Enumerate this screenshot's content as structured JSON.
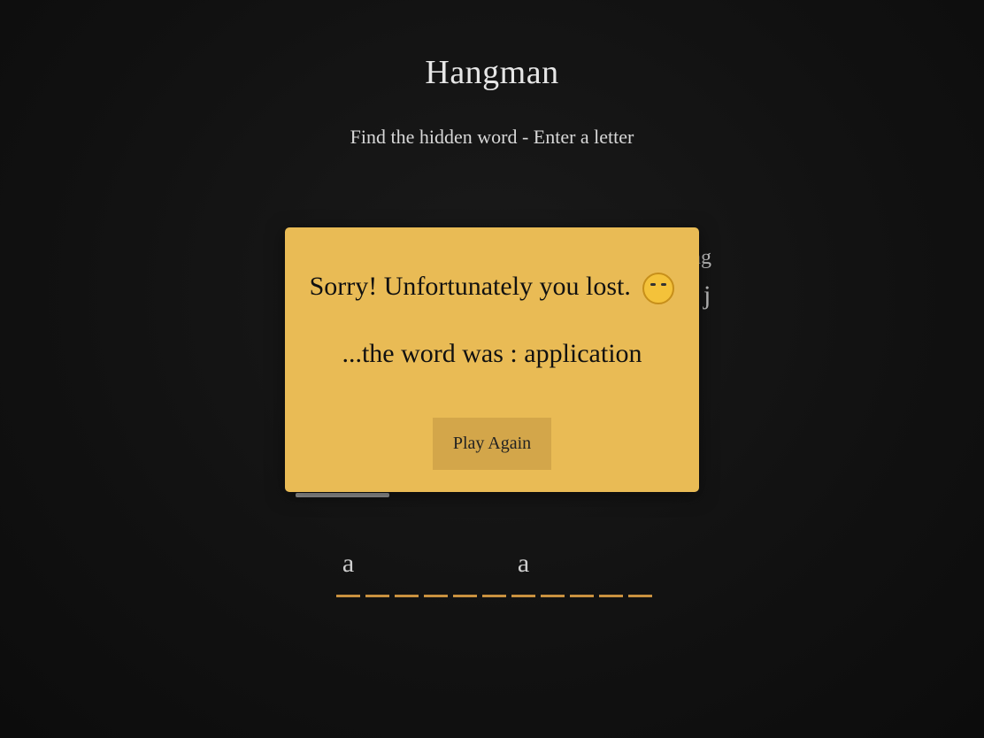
{
  "header": {
    "title": "Hangman",
    "subtitle": "Find the hidden word - Enter a letter"
  },
  "wrong_letters_peek": {
    "line1": "ng",
    "line2": ", j"
  },
  "word": {
    "slots": [
      "a",
      "",
      "",
      "",
      "",
      "",
      "a",
      "",
      "",
      "",
      ""
    ]
  },
  "modal": {
    "message": "Sorry! Unfortunately you lost.",
    "emoji_icon": "loudly-crying-face-icon",
    "word_line": "...the word was : application",
    "button_label": "Play Again"
  },
  "colors": {
    "modal_bg": "#e9bb55",
    "slot_underline": "#c9913f",
    "background": "#111111"
  }
}
